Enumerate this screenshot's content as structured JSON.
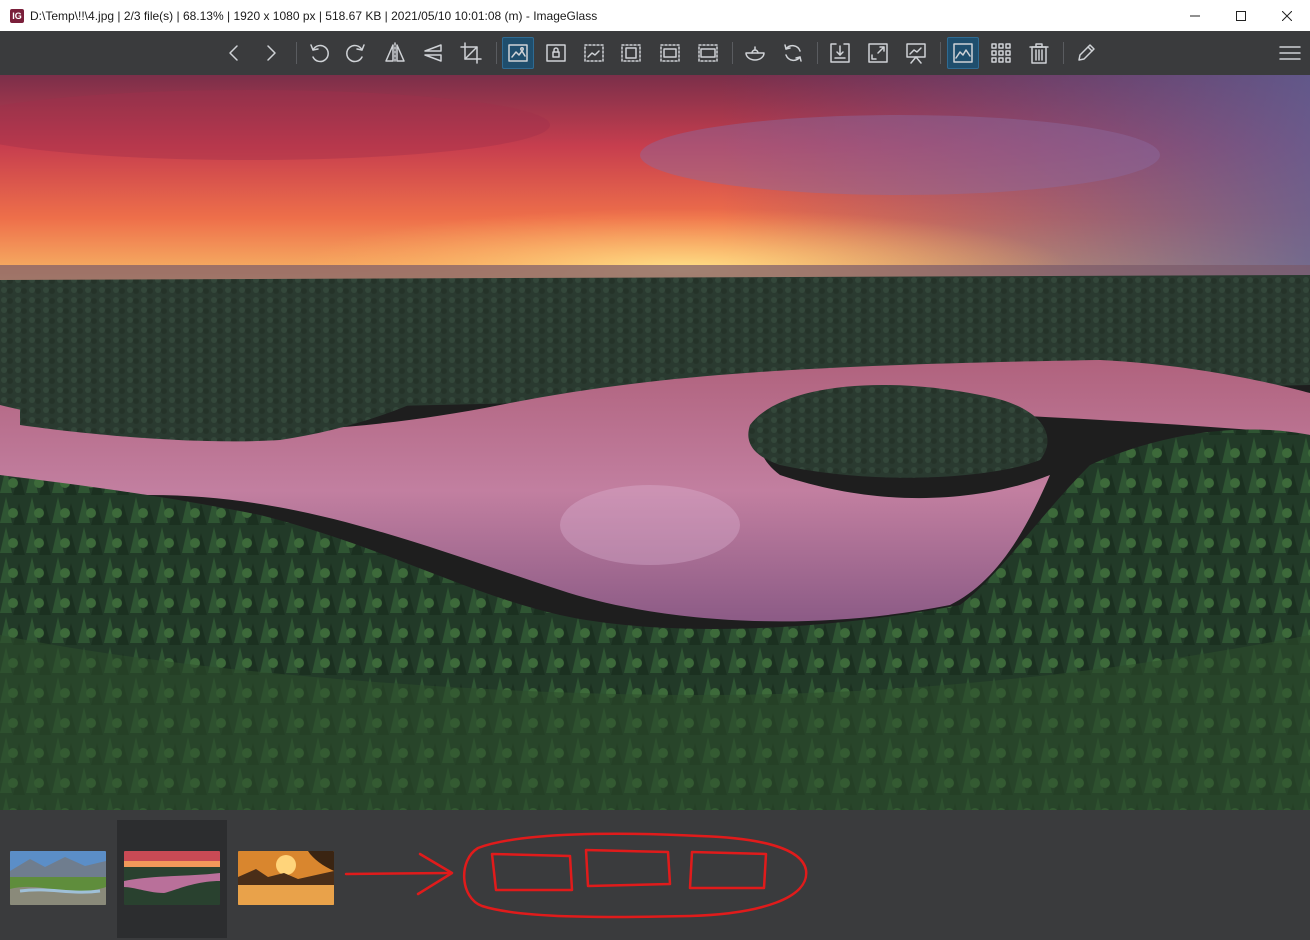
{
  "window": {
    "title": "D:\\Temp\\!!\\4.jpg  |  2/3 file(s)  |  68.13%  |  1920 x 1080 px  |  518.67 KB  |  2021/05/10 10:01:08 (m)  - ImageGlass",
    "app_icon_glyph": "IG"
  },
  "toolbar": {
    "buttons": [
      {
        "name": "previous-image-button",
        "icon": "chevron-left-icon"
      },
      {
        "name": "next-image-button",
        "icon": "chevron-right-icon"
      },
      {
        "name": "rotate-left-button",
        "icon": "rotate-left-icon"
      },
      {
        "name": "rotate-right-button",
        "icon": "rotate-right-icon"
      },
      {
        "name": "flip-horizontal-button",
        "icon": "flip-horizontal-icon"
      },
      {
        "name": "flip-vertical-button",
        "icon": "flip-vertical-icon"
      },
      {
        "name": "crop-button",
        "icon": "crop-icon"
      },
      {
        "name": "auto-zoom-button",
        "icon": "auto-zoom-icon",
        "active": true
      },
      {
        "name": "lock-zoom-button",
        "icon": "lock-zoom-icon"
      },
      {
        "name": "scale-to-width-button",
        "icon": "scale-width-icon"
      },
      {
        "name": "scale-to-height-button",
        "icon": "scale-height-icon"
      },
      {
        "name": "scale-to-fit-button",
        "icon": "scale-fit-icon"
      },
      {
        "name": "scale-to-fill-button",
        "icon": "scale-fill-icon"
      },
      {
        "name": "open-with-button",
        "icon": "bowl-icon"
      },
      {
        "name": "refresh-button",
        "icon": "refresh-icon"
      },
      {
        "name": "goto-image-button",
        "icon": "goto-icon"
      },
      {
        "name": "full-screen-button",
        "icon": "fullscreen-icon"
      },
      {
        "name": "slideshow-button",
        "icon": "slideshow-icon"
      },
      {
        "name": "thumbnail-bar-button",
        "icon": "thumbnail-icon",
        "active": true
      },
      {
        "name": "checkerboard-button",
        "icon": "grid-icon"
      },
      {
        "name": "delete-button",
        "icon": "trash-icon"
      },
      {
        "name": "edit-button",
        "icon": "pencil-icon"
      },
      {
        "name": "main-menu-button",
        "icon": "hamburger-icon"
      }
    ]
  },
  "thumbnails": [
    {
      "name": "thumbnail-mountain-lake",
      "selected": false
    },
    {
      "name": "thumbnail-sunset-lake",
      "selected": true
    },
    {
      "name": "thumbnail-golden-lake",
      "selected": false
    }
  ],
  "colors": {
    "toolbar_bg": "#3a3b3d",
    "active_button": "#1f4e6d",
    "annotation": "#e01b1b"
  }
}
